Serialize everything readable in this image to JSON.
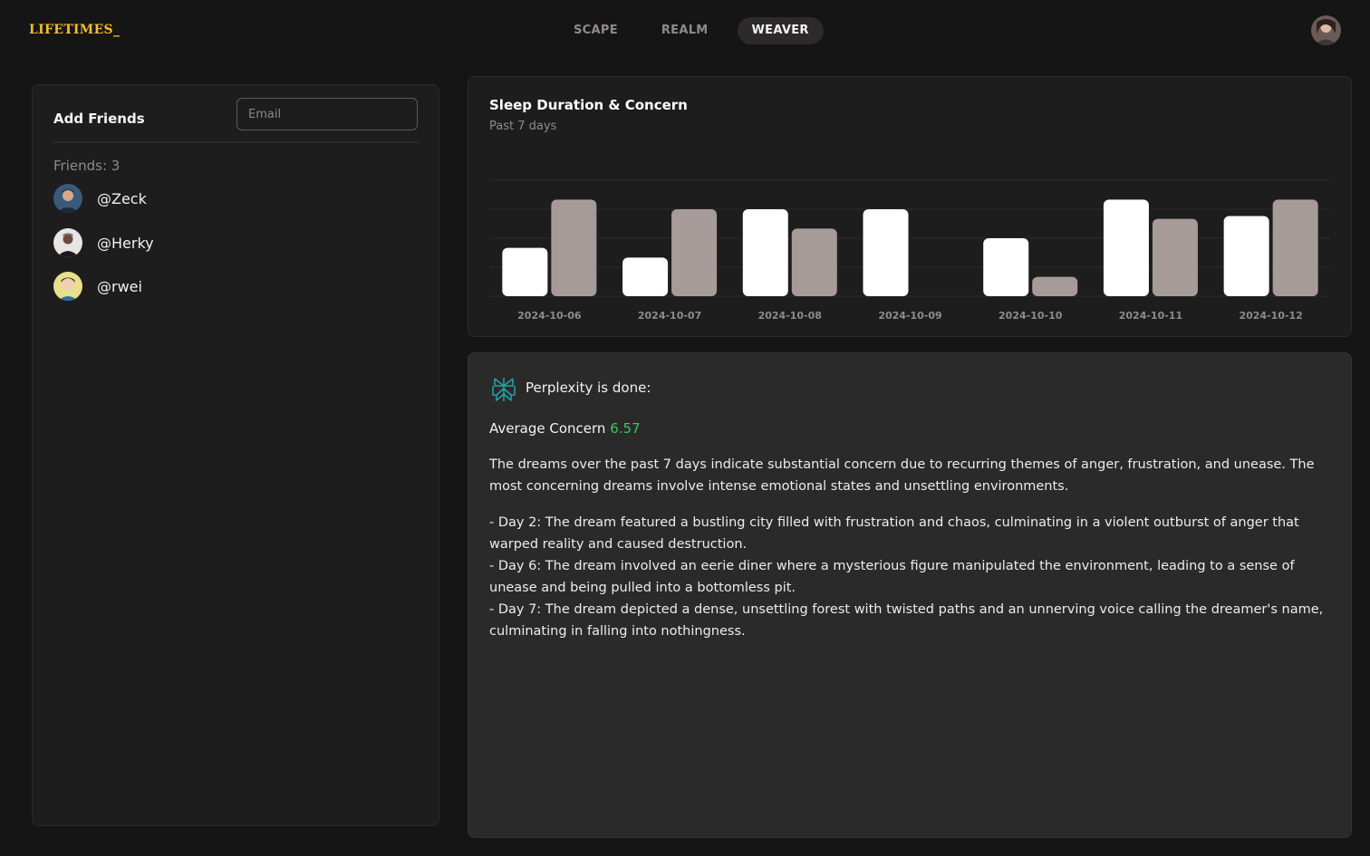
{
  "app": {
    "logo": "LIFETIMES_"
  },
  "nav": {
    "tabs": [
      "SCAPE",
      "REALM",
      "WEAVER"
    ],
    "active": "WEAVER"
  },
  "friends": {
    "title": "Add Friends",
    "email_placeholder": "Email",
    "count_label": "Friends: 3",
    "list": [
      {
        "handle": "@Zeck"
      },
      {
        "handle": "@Herky"
      },
      {
        "handle": "@rwei"
      }
    ]
  },
  "colors": {
    "background": "#161515",
    "logo": "#f2bd2e",
    "bar_primary": "#ffffff",
    "bar_secondary": "#a79b99",
    "concern_value": "#36c85e",
    "perplexity_icon": "#22a5a8"
  },
  "chart_data": {
    "type": "bar",
    "title": "Sleep Duration & Concern",
    "subtitle": "Past 7 days",
    "categories": [
      "2024-10-06",
      "2024-10-07",
      "2024-10-08",
      "2024-10-09",
      "2024-10-10",
      "2024-10-11",
      "2024-10-12"
    ],
    "series": [
      {
        "values": [
          5,
          4,
          9,
          9,
          6,
          10,
          8.3
        ]
      },
      {
        "values": [
          10,
          9,
          7,
          0,
          2,
          8,
          10
        ]
      }
    ],
    "ylim": [
      0,
      12
    ],
    "grid": true
  },
  "perplexity": {
    "icon": "perplexity-icon",
    "heading": "Perplexity is done:",
    "average_label": "Average Concern",
    "average_value": "6.57",
    "summary": "The dreams over the past 7 days indicate substantial concern due to recurring themes of anger, frustration, and unease. The most concerning dreams involve intense emotional states and unsettling environments.",
    "days": [
      "- Day 2: The dream featured a bustling city filled with frustration and chaos, culminating in a violent outburst of anger that warped reality and caused destruction.",
      "- Day 6: The dream involved an eerie diner where a mysterious figure manipulated the environment, leading to a sense of unease and being pulled into a bottomless pit.",
      "- Day 7: The dream depicted a dense, unsettling forest with twisted paths and an unnerving voice calling the dreamer's name, culminating in falling into nothingness."
    ]
  }
}
